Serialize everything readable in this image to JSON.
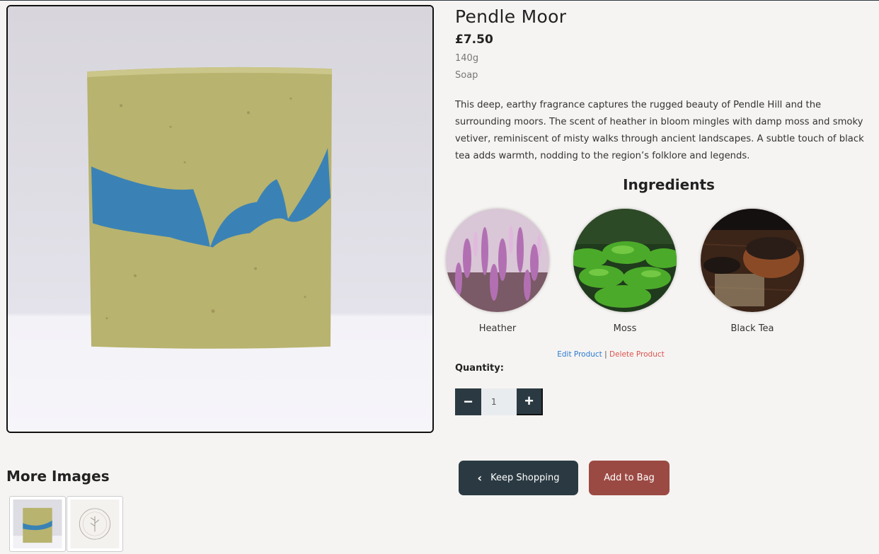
{
  "product": {
    "title": "Pendle Moor",
    "price": "£7.50",
    "weight": "140g",
    "category": "Soap",
    "description": "This deep, earthy fragrance captures the rugged beauty of Pendle Hill and the surrounding moors. The scent of heather in bloom mingles with damp moss and smoky vetiver, reminiscent of misty walks through ancient landscapes. A subtle touch of black tea adds warmth, nodding to the region’s folklore and legends."
  },
  "ingredients": {
    "heading": "Ingredients",
    "items": [
      {
        "label": "Heather",
        "image": "heather-flowers"
      },
      {
        "label": "Moss",
        "image": "green-moss"
      },
      {
        "label": "Black Tea",
        "image": "black-tea-bowl"
      }
    ]
  },
  "admin": {
    "edit_label": "Edit Product",
    "separator": "|",
    "delete_label": "Delete Product"
  },
  "quantity": {
    "label": "Quantity:",
    "value": "1",
    "minus": "−",
    "plus": "+"
  },
  "actions": {
    "keep_shopping": "Keep Shopping",
    "chevron_icon": "chevron-left-icon",
    "add_to_bag": "Add to Bag"
  },
  "gallery": {
    "heading": "More Images",
    "thumbnails": [
      "soap-bar",
      "brand-logo"
    ]
  },
  "colors": {
    "primary_dark": "#2b3a42",
    "accent_red": "#9b4a43",
    "link_blue": "#2b7bd1",
    "delete_red": "#d9534f",
    "soap_green": "#b8b36e",
    "soap_blue": "#3a82b5"
  }
}
